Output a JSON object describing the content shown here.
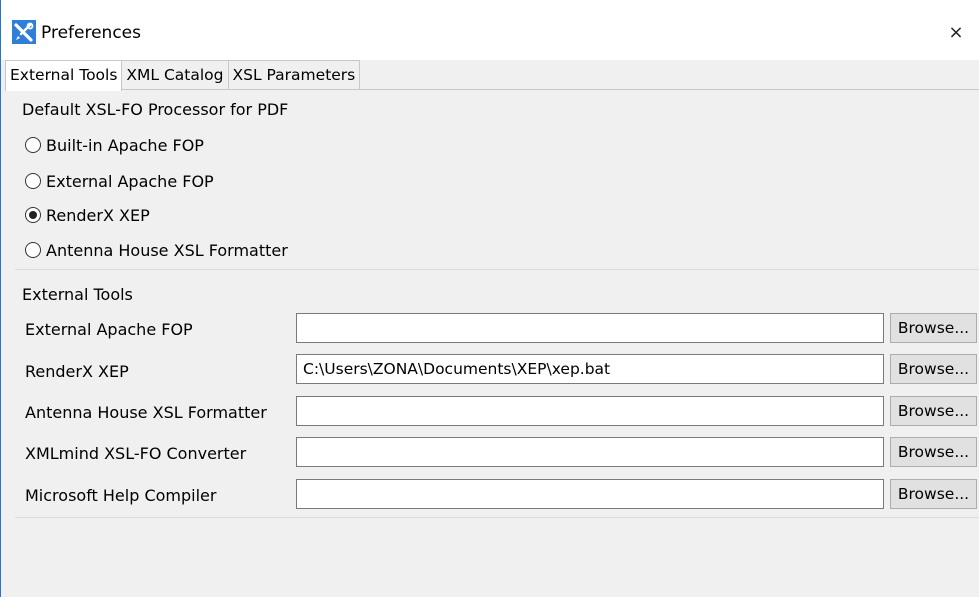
{
  "window": {
    "title": "Preferences",
    "close_symbol": "×"
  },
  "tabs": [
    {
      "label": "External Tools",
      "active": true
    },
    {
      "label": "XML Catalog",
      "active": false
    },
    {
      "label": "XSL Parameters",
      "active": false
    }
  ],
  "processor_group": {
    "header": "Default XSL-FO Processor for PDF",
    "options": [
      {
        "label": "Built-in Apache FOP",
        "checked": false
      },
      {
        "label": "External Apache FOP",
        "checked": false
      },
      {
        "label": "RenderX XEP",
        "checked": true
      },
      {
        "label": "Antenna House XSL Formatter",
        "checked": false
      }
    ]
  },
  "tools_group": {
    "header": "External Tools",
    "browse_label": "Browse...",
    "tools": [
      {
        "label": "External Apache FOP",
        "value": ""
      },
      {
        "label": "RenderX XEP",
        "value": "C:\\Users\\ZONA\\Documents\\XEP\\xep.bat"
      },
      {
        "label": "Antenna House XSL Formatter",
        "value": ""
      },
      {
        "label": "XMLmind XSL-FO Converter",
        "value": ""
      },
      {
        "label": "Microsoft Help Compiler",
        "value": ""
      }
    ]
  },
  "colors": {
    "accent": "#2b73c4",
    "icon_blue": "#2f7fd8"
  },
  "icons": {
    "app": "xmlmind-tools-icon",
    "close": "close-icon"
  }
}
